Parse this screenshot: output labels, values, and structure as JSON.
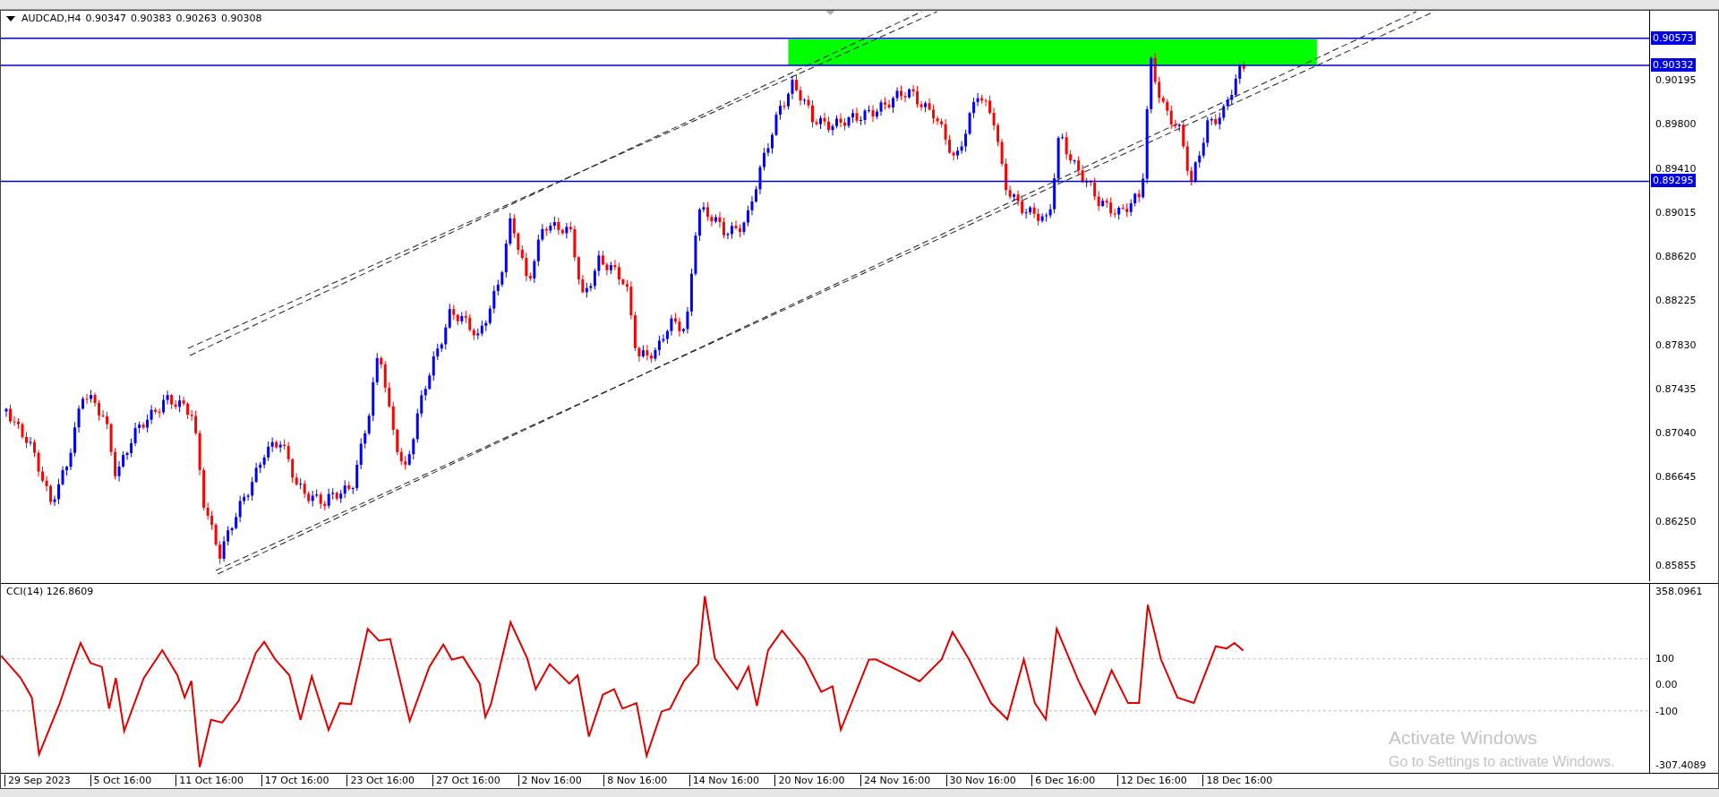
{
  "chart": {
    "symbol": "AUDCAD,H4",
    "ohlc": [
      "0.90347",
      "0.90383",
      "0.90263",
      "0.90308"
    ],
    "price_ticks": [
      "0.90195",
      "0.89800",
      "0.89410",
      "0.89015",
      "0.88620",
      "0.88225",
      "0.87830",
      "0.87435",
      "0.87040",
      "0.86645",
      "0.86250",
      "0.85855"
    ],
    "levels": [
      "0.90573",
      "0.90332",
      "0.89295"
    ]
  },
  "indicator": {
    "label": "CCI(14) 126.8609",
    "ticks": [
      "358.0961",
      "100",
      "0.00",
      "-100",
      "-307.4089"
    ]
  },
  "time_axis": [
    "29 Sep 2023",
    "5 Oct 16:00",
    "11 Oct 16:00",
    "17 Oct 16:00",
    "23 Oct 16:00",
    "27 Oct 16:00",
    "2 Nov 16:00",
    "8 Nov 16:00",
    "14 Nov 16:00",
    "20 Nov 16:00",
    "24 Nov 16:00",
    "30 Nov 16:00",
    "6 Dec 16:00",
    "12 Dec 16:00",
    "18 Dec 16:00"
  ],
  "activation_notice": {
    "title": "Activate Windows",
    "text": "Go to Settings to activate Windows."
  }
}
